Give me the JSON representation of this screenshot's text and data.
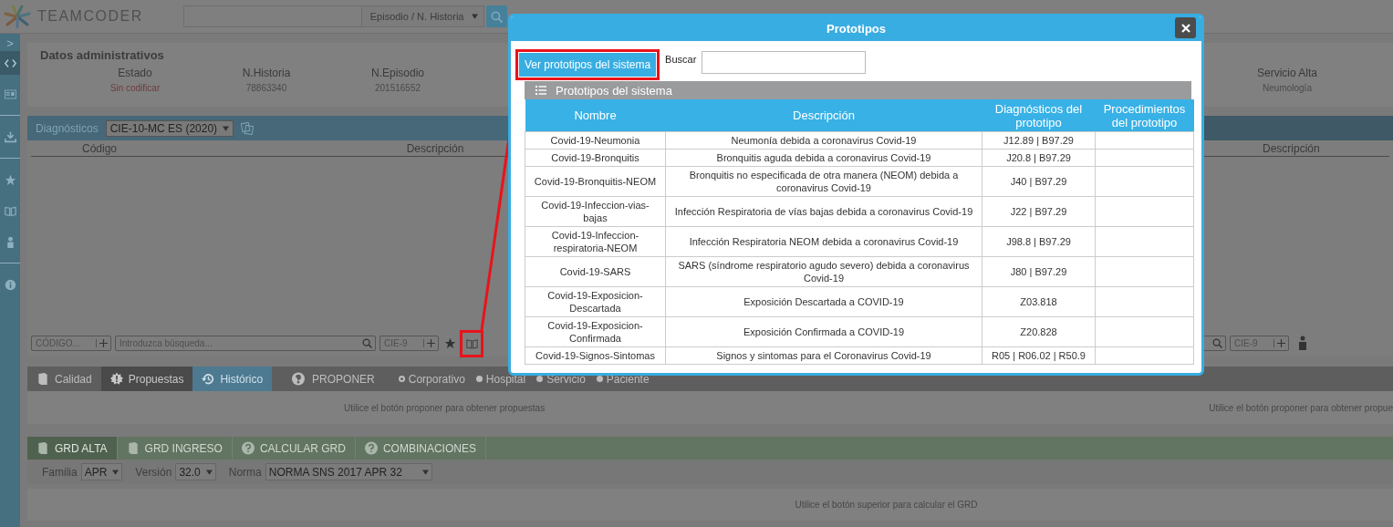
{
  "header": {
    "logo": "TEAMCODER",
    "search_scope": "Episodio / N. Historia"
  },
  "sidebar": {
    "toggle": ">",
    "items": [
      {
        "kind": "code",
        "selected": true
      },
      {
        "kind": "card",
        "selected": false
      },
      {
        "kind": "download",
        "selected": false
      },
      {
        "kind": "star",
        "selected": false
      },
      {
        "kind": "book",
        "selected": false
      },
      {
        "kind": "person",
        "selected": false
      },
      {
        "kind": "info",
        "selected": false
      }
    ]
  },
  "admin": {
    "title": "Datos administrativos",
    "fields": [
      {
        "label": "Estado",
        "value": "Sin codificar",
        "kind": "status"
      },
      {
        "label": "N.Historia",
        "value": "78863340",
        "kind": "plain"
      },
      {
        "label": "N.Episodio",
        "value": "201516552",
        "kind": "plain"
      }
    ],
    "service": {
      "label": "Servicio Alta",
      "value": "Neumología"
    }
  },
  "diagnoses": {
    "title": "Diagnósticos",
    "classification": "CIE-10-MC ES (2020)",
    "columns": [
      "Código",
      "Descripción"
    ],
    "code_placeholder": "CÓDIGO...",
    "search_placeholder": "Introduzca búsqueda...",
    "system": "CIE-9"
  },
  "procedures": {
    "columns": [
      "Descripción"
    ],
    "system": "CIE-9"
  },
  "proposal_tabs": [
    {
      "label": "Calidad",
      "kind": "book",
      "selected": false
    },
    {
      "label": "Propuestas",
      "kind": "alert",
      "selected": false
    },
    {
      "label": "Histórico",
      "kind": "history",
      "selected": true
    }
  ],
  "propose": {
    "label": "PROPONER"
  },
  "scopes": [
    {
      "label": "Corporativo",
      "selected": true
    },
    {
      "label": "Hospital",
      "selected": false
    },
    {
      "label": "Servicio",
      "selected": false
    },
    {
      "label": "Paciente",
      "selected": false
    }
  ],
  "proposal_messages": [
    "Utilice el botón proponer para obtener propuestas",
    "Utilice el botón proponer para obtener propue"
  ],
  "grd_tabs": [
    {
      "label": "GRD ALTA",
      "kind": "book",
      "selected": true
    },
    {
      "label": "GRD INGRESO",
      "kind": "book",
      "selected": false
    },
    {
      "label": "CALCULAR GRD",
      "kind": "help",
      "selected": false
    },
    {
      "label": "COMBINACIONES",
      "kind": "help",
      "selected": false
    }
  ],
  "grd_filters": [
    {
      "label": "Familia",
      "value": "APR"
    },
    {
      "label": "Versión",
      "value": "32.0"
    },
    {
      "label": "Norma",
      "value": "NORMA SNS 2017 APR 32"
    }
  ],
  "grd_message": "Utilice el botón superior para calcular el GRD",
  "modal": {
    "title": "Prototipos",
    "button": "Ver prototipos del sistema",
    "search_label": "Buscar",
    "section_title": "Prototipos del sistema",
    "columns": [
      "Nombre",
      "Descripción",
      "Diagnósticos del prototipo",
      "Procedimientos del prototipo"
    ],
    "rows": [
      {
        "name": "Covid-19-Neumonia",
        "description": "Neumonía debida a coronavirus Covid-19",
        "diagnoses": "J12.89 | B97.29"
      },
      {
        "name": "Covid-19-Bronquitis",
        "description": "Bronquitis aguda debida a coronavirus Covid-19",
        "diagnoses": "J20.8 | B97.29"
      },
      {
        "name": "Covid-19-Bronquitis-NEOM",
        "description": "Bronquitis no especificada de otra manera (NEOM) debida a coronavirus Covid-19",
        "diagnoses": "J40 | B97.29"
      },
      {
        "name": "Covid-19-Infeccion-vias-bajas",
        "description": "Infección Respiratoria de vías bajas debida a coronavirus Covid-19",
        "diagnoses": "J22 | B97.29"
      },
      {
        "name": "Covid-19-Infeccion-respiratoria-NEOM",
        "description": "Infección Respiratoria NEOM debida a coronavirus Covid-19",
        "diagnoses": "J98.8 | B97.29"
      },
      {
        "name": "Covid-19-SARS",
        "description": "SARS (síndrome respiratorio agudo severo) debida a coronavirus Covid-19",
        "diagnoses": "J80 | B97.29"
      },
      {
        "name": "Covid-19-Exposicion-Descartada",
        "description": "Exposición Descartada a COVID-19",
        "diagnoses": "Z03.818"
      },
      {
        "name": "Covid-19-Exposicion-Confirmada",
        "description": "Exposición Confirmada a COVID-19",
        "diagnoses": "Z20.828"
      },
      {
        "name": "Covid-19-Signos-Sintomas",
        "description": "Signos y sintomas para el Coronavirus Covid-19",
        "diagnoses": "R05 | R06.02 | R50.9"
      }
    ]
  }
}
